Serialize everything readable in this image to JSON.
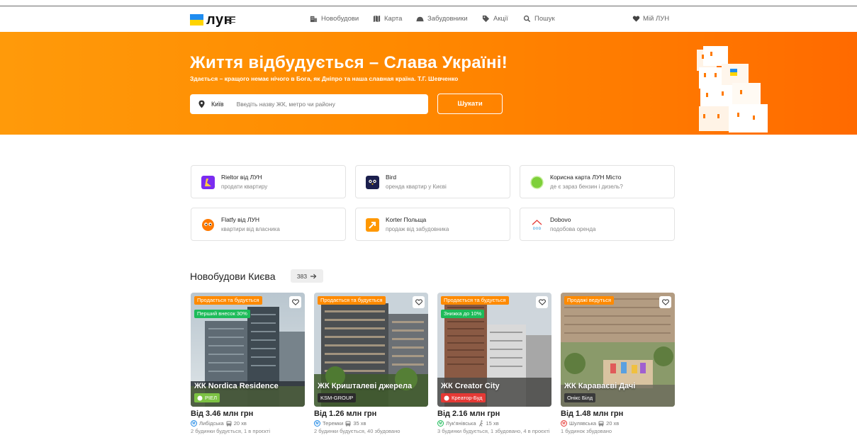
{
  "header": {
    "logo_text": "лун",
    "nav": [
      {
        "label": "Новобудови",
        "icon": "building-icon"
      },
      {
        "label": "Карта",
        "icon": "map-icon"
      },
      {
        "label": "Забудовники",
        "icon": "helmet-icon"
      },
      {
        "label": "Акції",
        "icon": "tag-icon"
      },
      {
        "label": "Пошук",
        "icon": "search-icon"
      }
    ],
    "my_lun": "Мій ЛУН"
  },
  "hero": {
    "title": "Життя відбудується – Слава Україні!",
    "subtitle": "Здається – кращого немає нічого в Бога, як Дніпро та наша славная країна. Т.Г. Шевченко",
    "city": "Київ",
    "search_placeholder": "Введіть назву ЖК, метро чи району",
    "search_button": "Шукати"
  },
  "services": [
    {
      "title": "Rieltor від ЛУН",
      "desc": "продати квартиру",
      "color": "#7b2cf0"
    },
    {
      "title": "Bird",
      "desc": "оренда квартир у Києві",
      "color": "#1b1f4d"
    },
    {
      "title": "Корисна карта ЛУН Місто",
      "desc": "де є зараз бензин і дизель?",
      "color": "#7ed03a"
    },
    {
      "title": "Flatfy від ЛУН",
      "desc": "квартири від власника",
      "color": "#ff7a00"
    },
    {
      "title": "Korter Польща",
      "desc": "продаж від забудовника",
      "color": "#ff9800"
    },
    {
      "title": "Dobovo",
      "desc": "подобова оренда",
      "color": "#4aa3df"
    }
  ],
  "section": {
    "title": "Новобудови Києва",
    "count": "383"
  },
  "listings": [
    {
      "status_badge": "Продається та будується",
      "promo_badge": "Перший внесок 30%",
      "name": "ЖК Nordica Residence",
      "developer": "РІЕЛ",
      "developer_color": "#7cc243",
      "price": "Від 3.46 млн грн",
      "metro": "Либідська",
      "metro_color": "#1e88e5",
      "transport": "20 хв",
      "summary": "2 будинки будується, 1 в проєкті"
    },
    {
      "status_badge": "Продається та будується",
      "promo_badge": "",
      "name": "ЖК Кришталеві джерела",
      "developer": "KSM-GROUP",
      "developer_color": "#2b2b2b",
      "price": "Від 1.26 млн грн",
      "metro": "Теремки",
      "metro_color": "#1e88e5",
      "transport": "35 хв",
      "summary": "2 будинки будується, 40 збудовано"
    },
    {
      "status_badge": "Продається та будується",
      "promo_badge": "Знижка до 10%",
      "name": "ЖК Creator City",
      "developer": "Креатор-Буд",
      "developer_color": "#e53935",
      "price": "Від 2.16 млн грн",
      "metro": "Лук'янівська",
      "metro_color": "#1dbb59",
      "transport": "15 хв",
      "summary": "3 будинки будується, 1 збудовано, 4 в проєкті"
    },
    {
      "status_badge": "Продажі ведуться",
      "promo_badge": "",
      "name": "ЖК Караваєві Дачі",
      "developer": "Онікс Білд",
      "developer_color": "#3a3a3a",
      "price": "Від 1.48 млн грн",
      "metro": "Шулявська",
      "metro_color": "#e53935",
      "transport": "20 хв",
      "summary": "1 будинок збудовано"
    }
  ]
}
